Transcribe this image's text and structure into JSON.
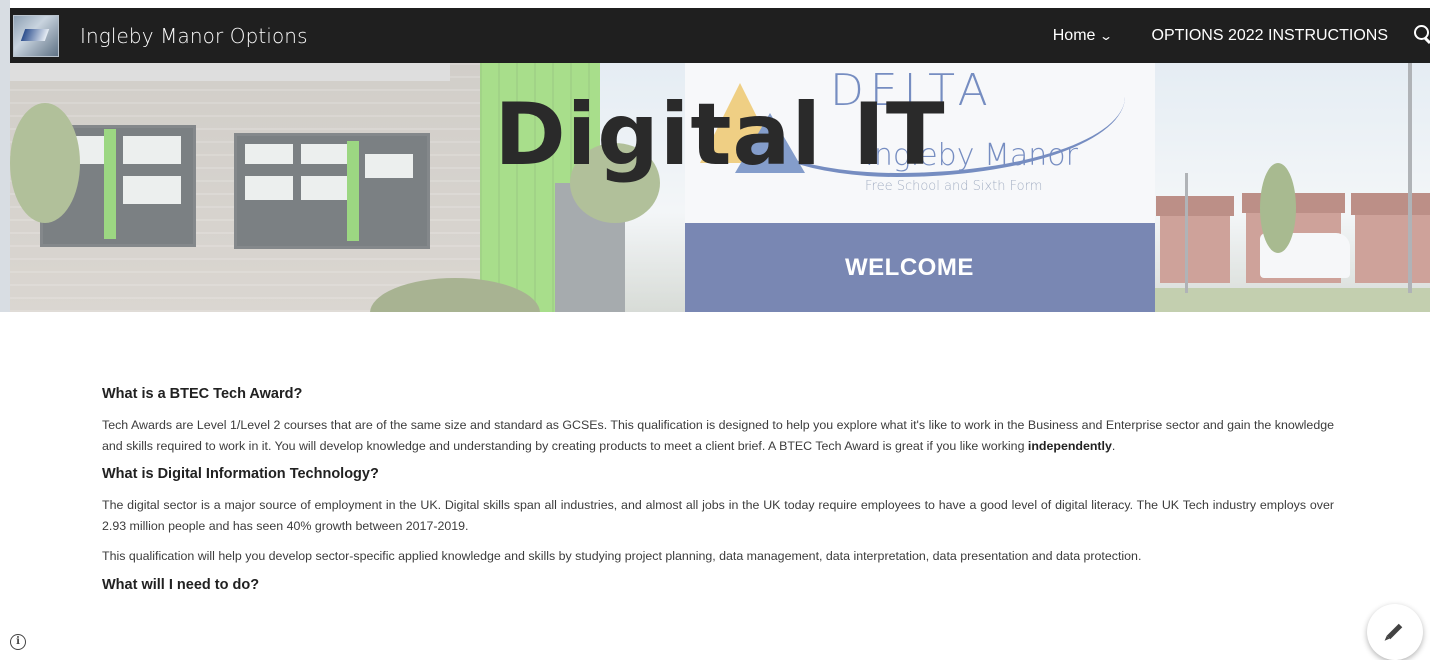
{
  "header": {
    "site_title": "Ingleby Manor Options",
    "nav": {
      "home_label": "Home",
      "instructions_label": "OPTIONS 2022 INSTRUCTIONS"
    }
  },
  "hero": {
    "title": "Digital IT",
    "sign": {
      "delta": "DELTA",
      "name": "Ingleby Manor",
      "subtitle": "Free School and Sixth Form",
      "welcome": "WELCOME"
    }
  },
  "content": {
    "sections": [
      {
        "heading": "What is a BTEC Tech Award?",
        "paragraphs": [
          {
            "text": "Tech Awards are Level 1/Level 2 courses that are of the same size and standard as GCSEs. This qualification is designed to help you explore what it's like to work in the Business and Enterprise sector and gain the knowledge and skills required to work in it. You will develop knowledge and understanding by creating products to meet a client brief. A BTEC Tech Award is great if you like working ",
            "bold": "independently",
            "after": "."
          }
        ]
      },
      {
        "heading": "What is Digital Information Technology?",
        "paragraphs": [
          {
            "text": "The digital sector is a major source of employment in the UK. Digital skills span all industries, and almost all jobs in the UK today require employees to have a good level of digital literacy. The UK Tech industry employs over 2.93 million people and has seen 40% growth between 2017-2019."
          },
          {
            "text": "This qualification will help you develop sector-specific applied knowledge and skills by studying project planning, data management, data interpretation, data presentation and data protection."
          }
        ]
      },
      {
        "heading": "What will I need to do?",
        "paragraphs": []
      }
    ]
  },
  "icons": {
    "info": "info-icon",
    "edit": "pencil-icon",
    "search": "search-icon",
    "home_dropdown": "chevron-down-icon"
  },
  "colors": {
    "topbar": "#1f1f1f",
    "hero_title": "#2a2a2a"
  }
}
